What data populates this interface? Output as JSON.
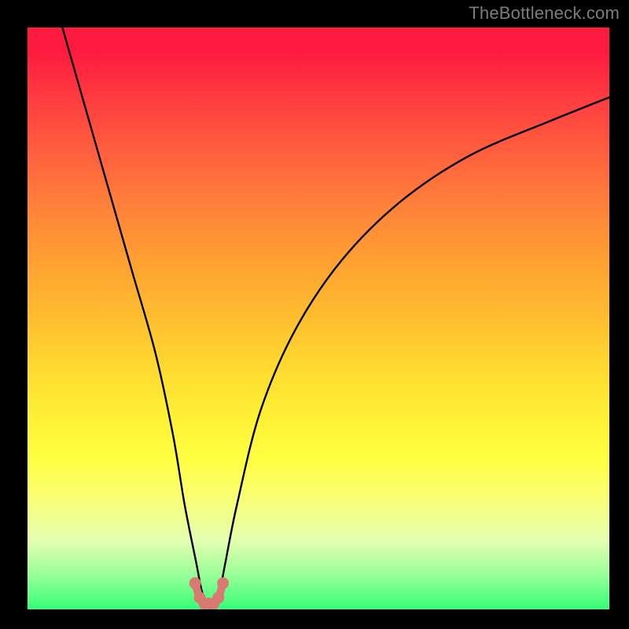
{
  "watermark": "TheBottleneck.com",
  "chart_data": {
    "type": "line",
    "title": "",
    "xlabel": "",
    "ylabel": "",
    "xlim": [
      0,
      100
    ],
    "ylim": [
      0,
      100
    ],
    "grid": false,
    "series": [
      {
        "name": "bottleneck-curve",
        "color": "#000000",
        "x": [
          6,
          10,
          14,
          18,
          22,
          25,
          27,
          29,
          30,
          31,
          32,
          33,
          34,
          36,
          40,
          46,
          54,
          64,
          76,
          90,
          100
        ],
        "values": [
          100,
          86,
          72,
          58,
          44,
          30,
          18,
          8,
          3,
          1,
          1,
          3,
          8,
          18,
          34,
          48,
          60,
          70,
          78,
          84,
          88
        ]
      },
      {
        "name": "highlight-minimum",
        "color": "#d87a72",
        "style": "markers",
        "x": [
          28.8,
          29.6,
          30.4,
          31.2,
          32,
          32.8,
          33.6
        ],
        "values": [
          4.5,
          2.0,
          1.0,
          1.0,
          1.0,
          2.0,
          4.5
        ]
      }
    ],
    "background_gradient": {
      "direction": "top-to-bottom",
      "stops": [
        {
          "pos": 0.0,
          "color": "#ff1a3f"
        },
        {
          "pos": 0.3,
          "color": "#ff7f3a"
        },
        {
          "pos": 0.55,
          "color": "#ffd830"
        },
        {
          "pos": 0.75,
          "color": "#ffff40"
        },
        {
          "pos": 0.9,
          "color": "#d0ffa0"
        },
        {
          "pos": 1.0,
          "color": "#34ff78"
        }
      ]
    }
  }
}
